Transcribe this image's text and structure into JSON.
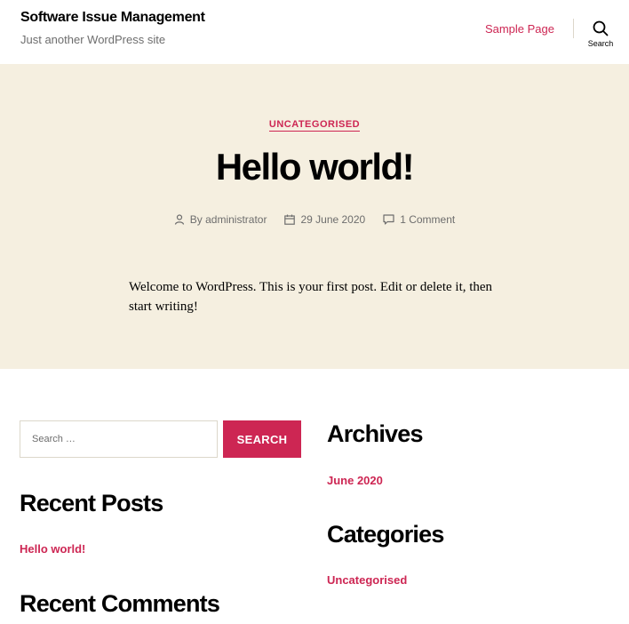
{
  "header": {
    "site_title": "Software Issue Management",
    "site_description": "Just another WordPress site",
    "nav": [
      {
        "label": "Sample Page"
      }
    ],
    "search_label": "Search"
  },
  "post": {
    "category": "UNCATEGORISED",
    "title": "Hello world!",
    "author": "By administrator",
    "date": "29 June 2020",
    "comments": "1 Comment",
    "content": "Welcome to WordPress. This is your first post. Edit or delete it, then start writing!"
  },
  "widgets": {
    "search": {
      "placeholder": "Search …",
      "button_label": "SEARCH"
    },
    "recent_posts": {
      "title": "Recent Posts",
      "items": [
        "Hello world!"
      ]
    },
    "recent_comments": {
      "title": "Recent Comments"
    },
    "archives": {
      "title": "Archives",
      "items": [
        "June 2020"
      ]
    },
    "categories": {
      "title": "Categories",
      "items": [
        "Uncategorised"
      ]
    }
  },
  "colors": {
    "accent": "#cd2653",
    "hero_background": "#f5efe0",
    "muted_text": "#6d6d6d"
  }
}
